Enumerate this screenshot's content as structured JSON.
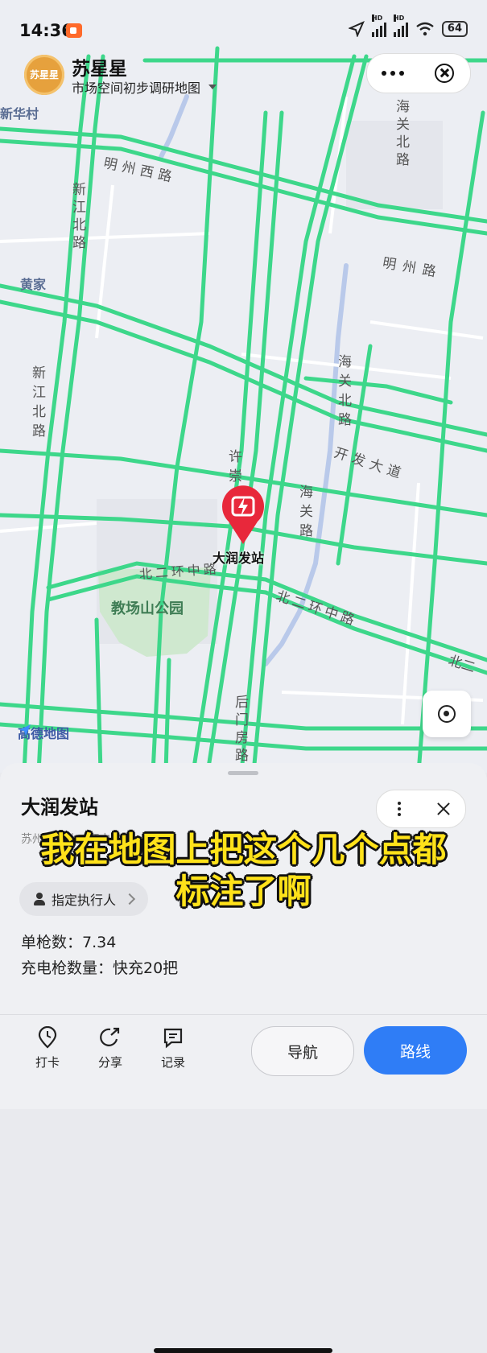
{
  "status_bar": {
    "time": "14:36",
    "battery": "64",
    "signal_labels": [
      "HD",
      "HD"
    ]
  },
  "app": {
    "logo_text": "苏星星",
    "name": "苏星星",
    "subtitle": "市场空间初步调研地图"
  },
  "map": {
    "provider_label": "高德地图",
    "place_labels": {
      "xinhuacun": "新华村",
      "mingzhou_west": "明州西路",
      "xinjiang_north_1": "新江北路",
      "huangjia": "黄家",
      "haiguan_north_1": "海关北路",
      "mingzhou": "明州路",
      "haiguan_north_2": "海关北路",
      "xinjiang_north_2": "新江北路",
      "kaifa": "开发大道",
      "xuchong": "许崇",
      "haiguan": "海关路",
      "north_ring_1": "北二环中路",
      "north_ring_2": "北二环中路",
      "park": "教场山公园",
      "houmen": "后门房路",
      "north_edge": "北二"
    },
    "marker_label": "大润发站",
    "accent_color": "#3dd78a",
    "marker_color": "#e8283b"
  },
  "sheet": {
    "title": "大润发站",
    "address": "苏州市 · 北二环中路",
    "assignee_label": "指定执行人",
    "gun_count_label": "单枪数：7.34",
    "charger_label": "充电枪数量：快充20把"
  },
  "bottom_bar": {
    "checkin": "打卡",
    "share": "分享",
    "record": "记录",
    "navigate": "导航",
    "route": "路线",
    "route_color": "#2f7df6"
  },
  "caption": {
    "line1": "我在地图上把这个几个点都",
    "line2": "标注了啊"
  }
}
